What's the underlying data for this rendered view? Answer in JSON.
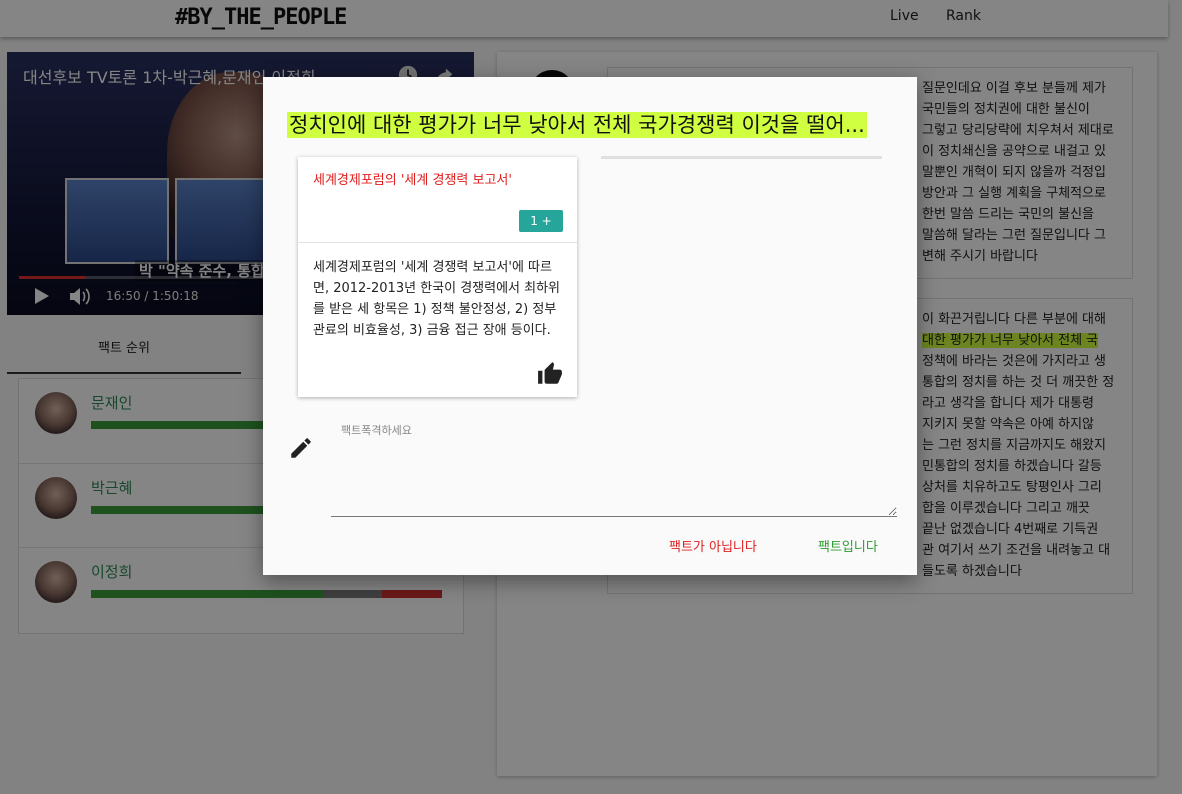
{
  "header": {
    "logo": "#BY_THE_PEOPLE",
    "nav": [
      "Live",
      "Rank"
    ]
  },
  "video": {
    "title": "대선후보 TV토론 1차-박근혜,문재인,이정희",
    "caption": "박 \"약속 준수, 통합, 청",
    "time": "16:50 / 1:50:18",
    "progress_fraction": 0.15
  },
  "rank": {
    "tab_label": "팩트 순위",
    "candidates": [
      {
        "name": "문재인",
        "bar": [
          {
            "color": "#3c9b3c",
            "fraction": 0.5
          }
        ]
      },
      {
        "name": "박근혜",
        "bar": [
          {
            "color": "#3c9b3c",
            "fraction": 0.5
          }
        ]
      },
      {
        "name": "이정희",
        "bar": [
          {
            "color": "#3c9b3c",
            "fraction": 0.66
          },
          {
            "color": "#7a7a7a",
            "fraction": 0.17
          },
          {
            "color": "#d03030",
            "fraction": 0.17
          }
        ]
      }
    ]
  },
  "transcript": {
    "card1_lines": [
      "질문인데요 이걸 후보 분들께 제가",
      "국민들의 정치권에 대한 불신이",
      "그렇고 당리당략에 치우쳐서 제대로",
      "이 정치쇄신을 공약으로 내걸고 있",
      "말뿐인 개혁이 되지 않을까 걱정입",
      "방안과 그 실행 계획을 구체적으로",
      "한번 말씀 드리는 국민의 불신을",
      "말씀해 달라는 그런 질문입니다 그",
      "변해 주시기 바랍니다"
    ],
    "card2_lines": [
      "이 화끈거립니다 다른 부분에 대해",
      "대한 평가가 너무 낮아서 전체 국",
      "정책에 바라는 것은에 가지라고 생",
      "통합의 정치를 하는 것 더 깨끗한 정",
      "라고 생각을 합니다 제가 대통령",
      "지키지 못할 약속은 아예 하지않",
      "는 그런 정치를 지금까지도 해왔지",
      "민통합의 정치를 하겠습니다 갈등",
      "상처를 치유하고도 탕평인사 그리",
      "합을 이루겠습니다 그리고 깨끗",
      "끝난 없겠습니다 4번째로 기득권",
      "관 여기서 쓰기 조건을 내려놓고 대",
      "들도록 하겠습니다"
    ],
    "highlight_line_index": 1
  },
  "dialog": {
    "title": "정치인에 대한 평가가 너무 낮아서 전체 국가경쟁력 이것을 떨어...",
    "fact": {
      "source": "세계경제포럼의 '세계 경쟁력 보고서'",
      "badge": "1 +",
      "body": "세계경제포럼의 '세계 경쟁력 보고서'에 따르면, 2012-2013년 한국이 경쟁력에서 최하위를 받은 세 항목은 1) 정책 불안정성, 2) 정부 관료의 비효율성, 3) 금융 접근 장애 등이다."
    },
    "input_label": "팩트폭격하세요",
    "input_value": "",
    "not_fact_button": "팩트가 아닙니다",
    "fact_button": "팩트입니다"
  },
  "colors": {
    "highlight": "#cfff40",
    "accent_teal": "#26a69a",
    "danger": "#e02020",
    "success": "#2e9b2e"
  },
  "icons": [
    "play-icon",
    "volume-icon",
    "clock-icon",
    "share-icon",
    "thumb-up-icon",
    "pencil-icon"
  ]
}
